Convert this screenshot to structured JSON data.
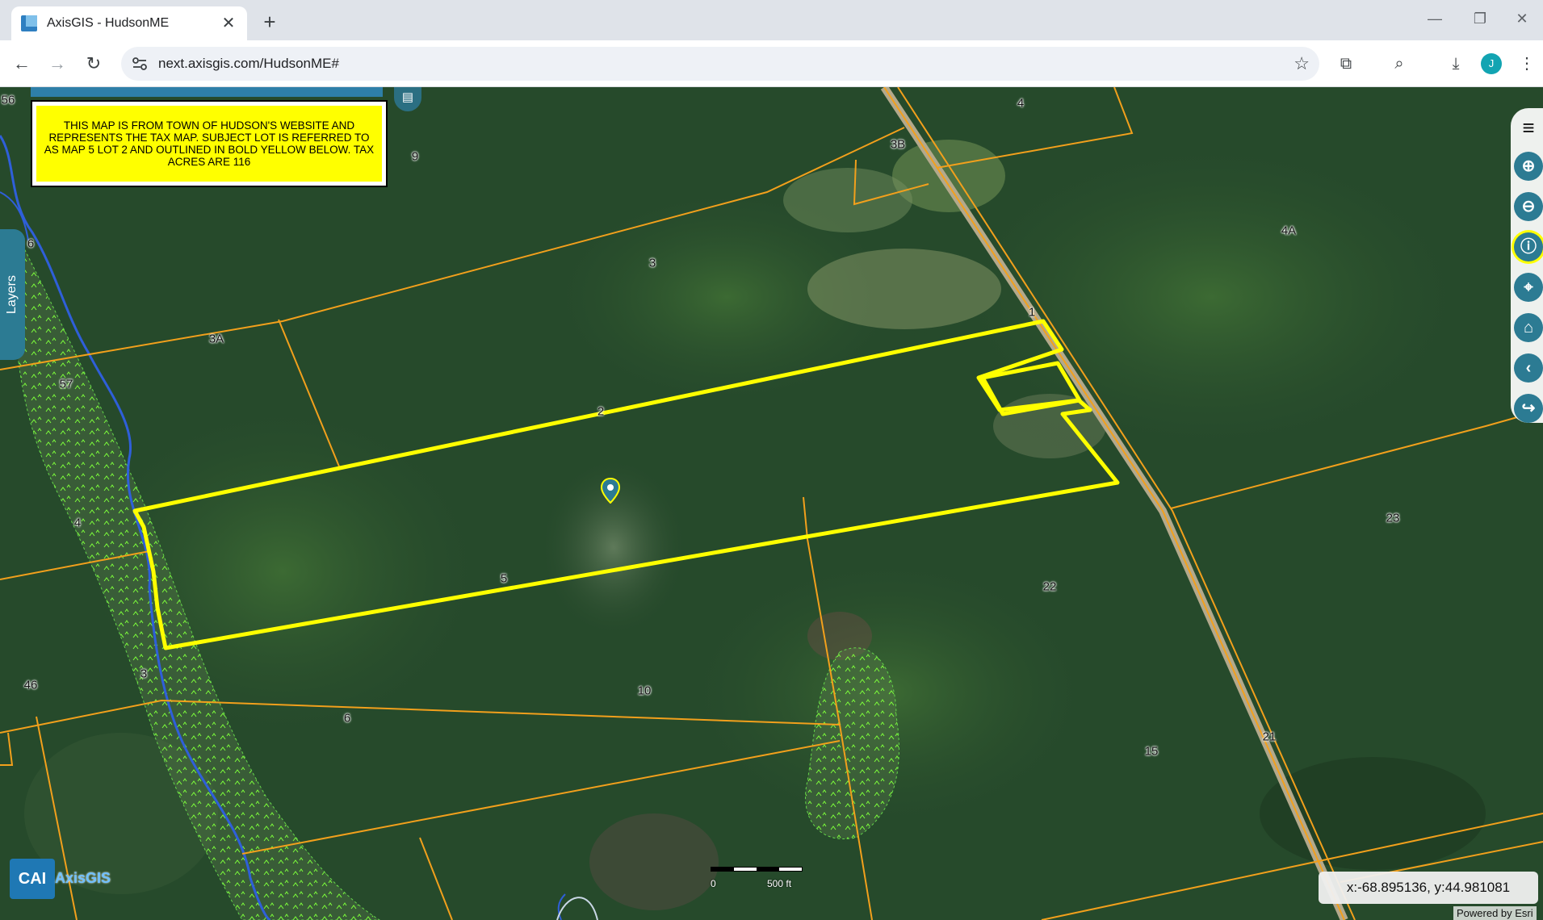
{
  "browser": {
    "tab_title": "AxisGIS - HudsonME",
    "new_tab_symbol": "+",
    "url": "next.axisgis.com/HudsonME#",
    "profile_initial": "J"
  },
  "map": {
    "notice_text": "THIS MAP IS FROM TOWN OF HUDSON'S WEBSITE AND REPRESENTS THE TAX MAP.  SUBJECT LOT IS REFERRED TO AS MAP 5 LOT 2 AND OUTLINED IN BOLD YELLOW BELOW.  TAX ACRES ARE 116",
    "layers_label": "Layers",
    "coordinates": "x:-68.895136, y:44.981081",
    "powered_by": "Powered by Esri",
    "scale_start": "0",
    "scale_end": "500 ft",
    "logo_mark": "CAI",
    "logo_text": "AxisGIS",
    "parcel_labels": [
      "56",
      "9",
      "4",
      "3B",
      "3",
      "4A",
      "6",
      "3A",
      "1",
      "57",
      "2",
      "4",
      "5",
      "22",
      "23",
      "46",
      "3",
      "10",
      "6",
      "21",
      "15"
    ],
    "highlight_color": "#ffff00",
    "parcel_line_color": "#f2a01c",
    "accent_color": "#2c7b93"
  },
  "icons": {
    "menu": "menu-icon",
    "zoom_in": "zoom-in-icon",
    "zoom_out": "zoom-out-icon",
    "identify": "info-icon",
    "locate": "locate-icon",
    "home": "home-icon",
    "back": "chevron-left-icon",
    "share": "share-icon"
  }
}
